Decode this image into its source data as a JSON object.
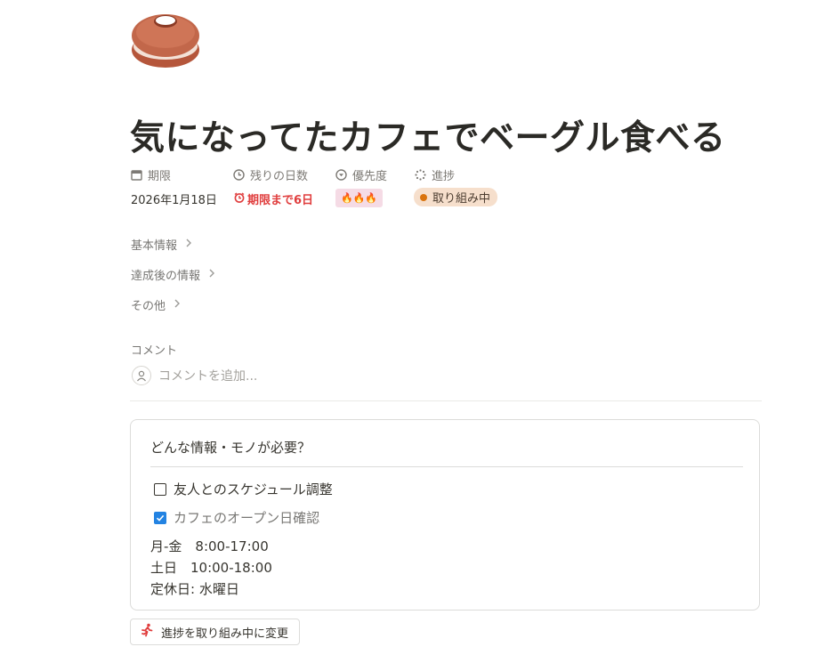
{
  "page": {
    "icon": "bagel-icon",
    "title": "気になってたカフェでベーグル食べる"
  },
  "properties": [
    {
      "icon": "calendar-icon",
      "label": "期限",
      "value": "2026年1月18日"
    },
    {
      "icon": "clock-icon",
      "label": "残りの日数",
      "value": "期限まで6日",
      "value_color": "#e03e3e"
    },
    {
      "icon": "priority-icon",
      "label": "優先度",
      "value": "🔥🔥🔥",
      "badge_color": "#f5dbe5"
    },
    {
      "icon": "progress-icon",
      "label": "進捗",
      "value": "取り組み中",
      "badge_color": "#f6dfcc",
      "dot_color": "#d9730d"
    }
  ],
  "toggles": [
    "基本情報",
    "達成後の情報",
    "その他"
  ],
  "comments": {
    "label": "コメント",
    "placeholder": "コメントを追加..."
  },
  "callout": {
    "title": "どんな情報・モノが必要？",
    "todos": [
      {
        "text": "友人とのスケジュール調整",
        "checked": false
      },
      {
        "text": "カフェのオープン日確認",
        "checked": true
      }
    ],
    "hours": [
      "月-金　8:00-17:00",
      "土日　10:00-18:00",
      "定休日: 水曜日"
    ]
  },
  "action_button": {
    "icon": "running-person-icon",
    "label": "進捗を取り組み中に変更"
  },
  "colors": {
    "deadline_red": "#e03e3e",
    "checkbox_blue": "#2383e2",
    "status_orange": "#d9730d"
  }
}
